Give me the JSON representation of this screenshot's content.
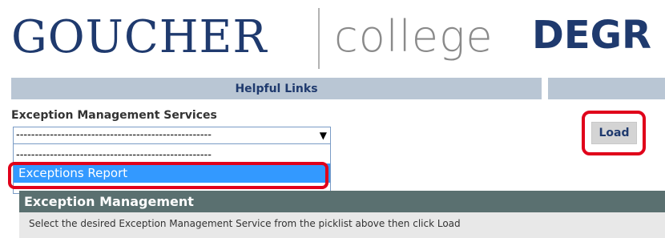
{
  "logo": {
    "goucher": "GOUCHER",
    "college": "college",
    "degr": "DEGR"
  },
  "helpful_links": {
    "title": "Helpful Links"
  },
  "exception_services": {
    "label": "Exception Management Services",
    "selected_value": "----------------------------------------------------",
    "arrow": "▼",
    "options": [
      "----------------------------------------------------",
      "Exceptions Report"
    ],
    "highlighted_option": "Exceptions Report"
  },
  "load_button": {
    "label": "Load"
  },
  "exception_management": {
    "title": "Exception Management",
    "instructions": "Select the desired Exception Management Service from the picklist above then click Load"
  },
  "colors": {
    "brand_navy": "#1f3a6e",
    "header_bar": "#b9c6d4",
    "section_header": "#5a7070",
    "highlight_red": "#e0001a",
    "selection_blue": "#3399ff"
  }
}
